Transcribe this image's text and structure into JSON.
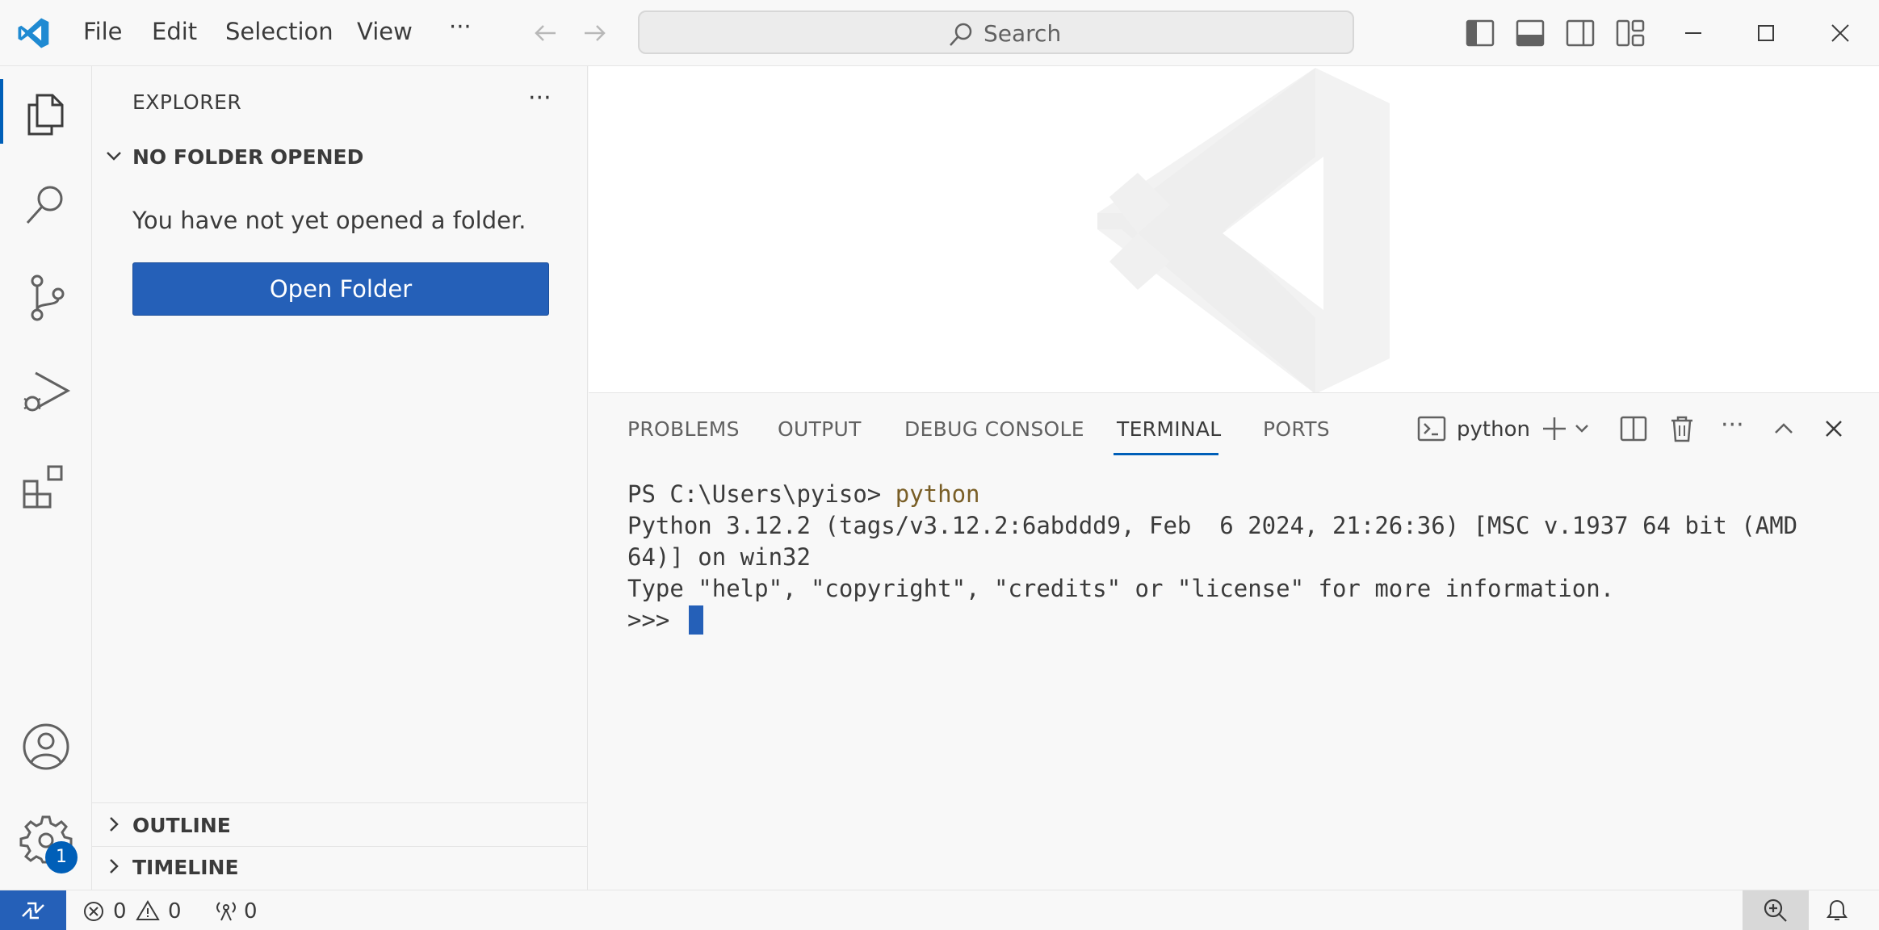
{
  "menu": {
    "file": "File",
    "edit": "Edit",
    "selection": "Selection",
    "view": "View",
    "more": "···"
  },
  "search": {
    "placeholder": "Search"
  },
  "sidebar": {
    "title": "EXPLORER",
    "more": "···",
    "no_folder_section": "NO FOLDER OPENED",
    "message": "You have not yet opened a folder.",
    "open_folder_button": "Open Folder",
    "outline_section": "OUTLINE",
    "timeline_section": "TIMELINE"
  },
  "activitybar": {
    "settings_badge": "1"
  },
  "panel": {
    "tabs": [
      "PROBLEMS",
      "OUTPUT",
      "DEBUG CONSOLE",
      "TERMINAL",
      "PORTS"
    ],
    "active_tab": "TERMINAL",
    "terminal_name": "python",
    "more": "···"
  },
  "terminal": {
    "prompt": "PS C:\\Users\\pyiso> ",
    "command": "python",
    "line2": "Python 3.12.2 (tags/v3.12.2:6abddd9, Feb  6 2024, 21:26:36) [MSC v.1937 64 bit (AMD",
    "line3": "64)] on win32",
    "line4": "Type \"help\", \"copyright\", \"credits\" or \"license\" for more information.",
    "repl_prompt": ">>> "
  },
  "statusbar": {
    "errors": "0",
    "warnings": "0",
    "ports": "0"
  },
  "colors": {
    "accent": "#005fb8",
    "button": "#2560b8",
    "command": "#795e26"
  }
}
